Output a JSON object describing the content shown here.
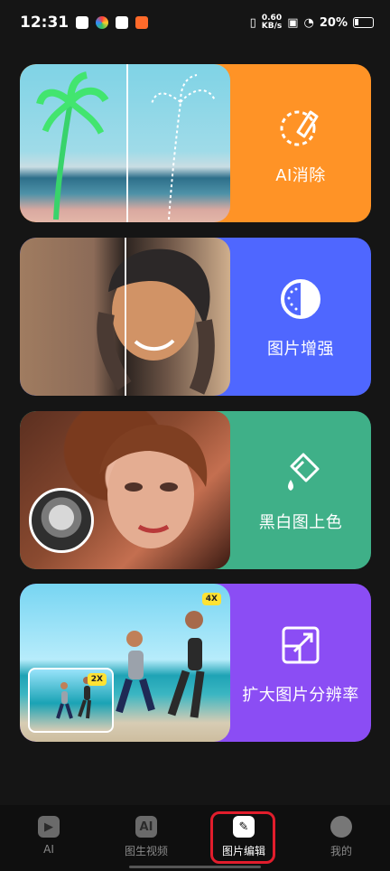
{
  "status_bar": {
    "time": "12:31",
    "network_speed": "0.60",
    "network_unit": "KB/s",
    "battery": "20%"
  },
  "cards": [
    {
      "title": "AI消除"
    },
    {
      "title": "图片增强"
    },
    {
      "title": "黑白图上色"
    },
    {
      "title": "扩大图片分辨率",
      "badge_small": "2X",
      "badge_large": "4X"
    }
  ],
  "bottom_nav": [
    {
      "label": "AI",
      "icon": "ai-icon"
    },
    {
      "label": "图生视频",
      "icon": "video-ai-icon"
    },
    {
      "label": "图片编辑",
      "icon": "image-edit-icon"
    },
    {
      "label": "我的",
      "icon": "profile-icon"
    }
  ],
  "colors": {
    "card_1": "#ff9326",
    "card_2": "#4f67ff",
    "card_3": "#3fb088",
    "card_4": "#8b4df4",
    "highlight": "#e11d2c"
  }
}
